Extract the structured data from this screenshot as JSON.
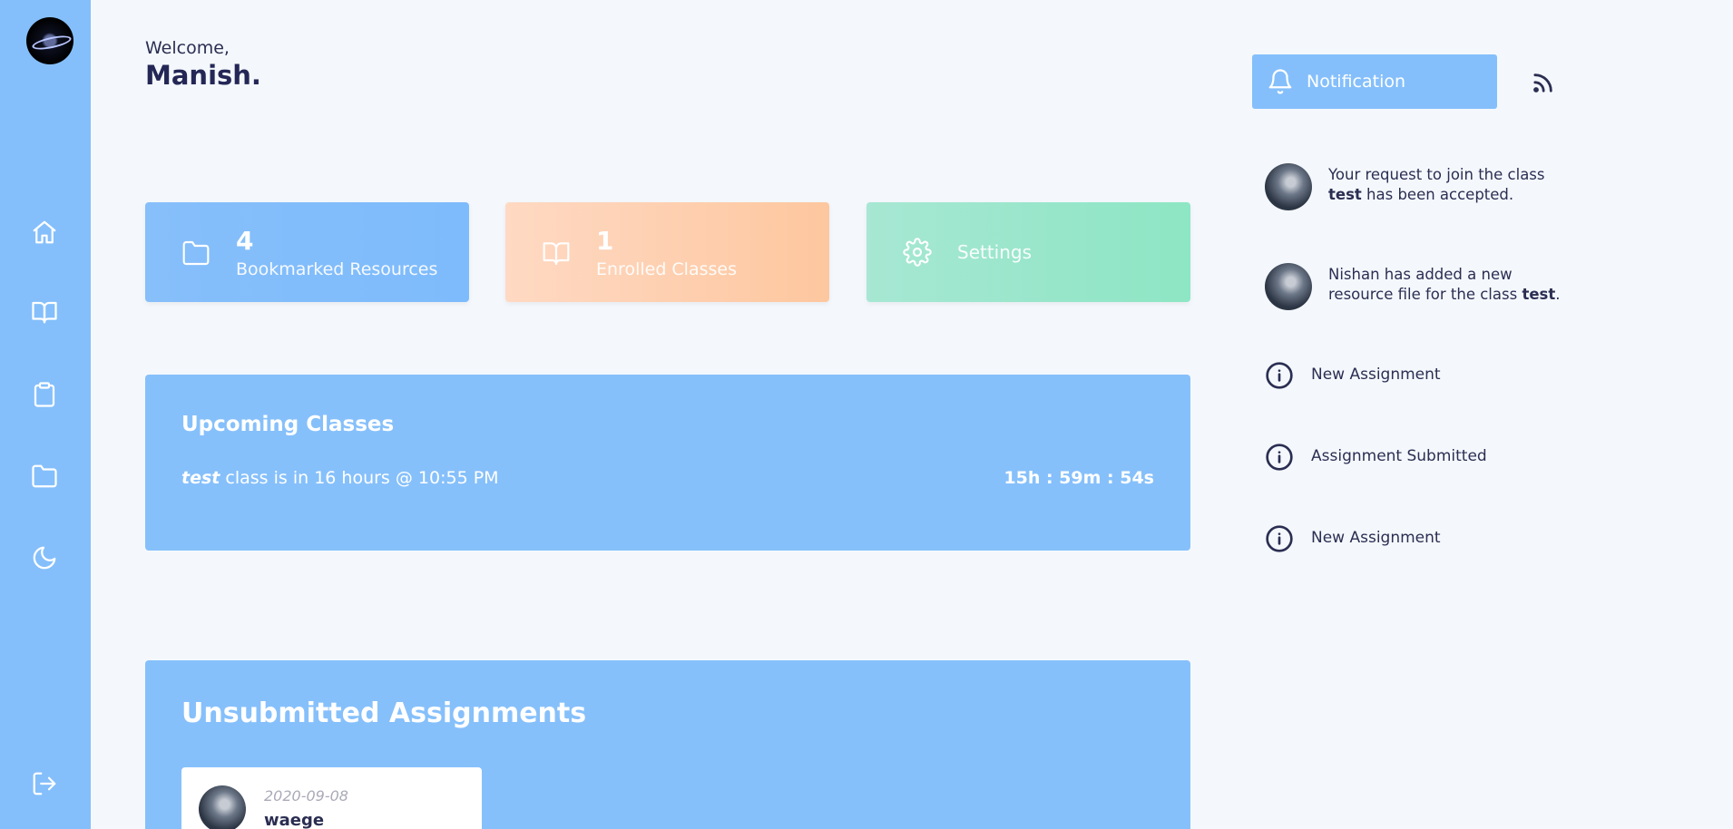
{
  "header": {
    "welcome": "Welcome,",
    "username": "Manish."
  },
  "stats": {
    "bookmarked_count": "4",
    "bookmarked_label": "Bookmarked Resources",
    "enrolled_count": "1",
    "enrolled_label": "Enrolled Classes",
    "settings_label": "Settings"
  },
  "upcoming": {
    "title": "Upcoming Classes",
    "class_name": "test",
    "class_text": " class is in 16 hours @ 10:55 PM",
    "countdown": "15h : 59m : 54s"
  },
  "unsubmitted": {
    "title": "Unsubmitted Assignments",
    "items": [
      {
        "date": "2020-09-08",
        "name": "waege"
      }
    ]
  },
  "notifications": {
    "button_label": "Notification",
    "items": [
      {
        "pre": "Your request to join the class ",
        "bold": "test",
        "post": " has been accepted."
      },
      {
        "pre": "Nishan has added a new resource file for the class ",
        "bold": "test",
        "post": "."
      },
      {
        "text": "New Assignment"
      },
      {
        "text": "Assignment Submitted"
      },
      {
        "text": "New Assignment"
      }
    ]
  },
  "sidebar": {
    "icons": [
      "home-icon",
      "book-open-icon",
      "clipboard-icon",
      "folder-icon",
      "moon-icon",
      "logout-icon"
    ]
  },
  "colors": {
    "primary": "#84bffb",
    "orange": "#fdc79f",
    "green": "#8de6c4",
    "text": "#2b2e52",
    "background": "#f4f8fc"
  }
}
